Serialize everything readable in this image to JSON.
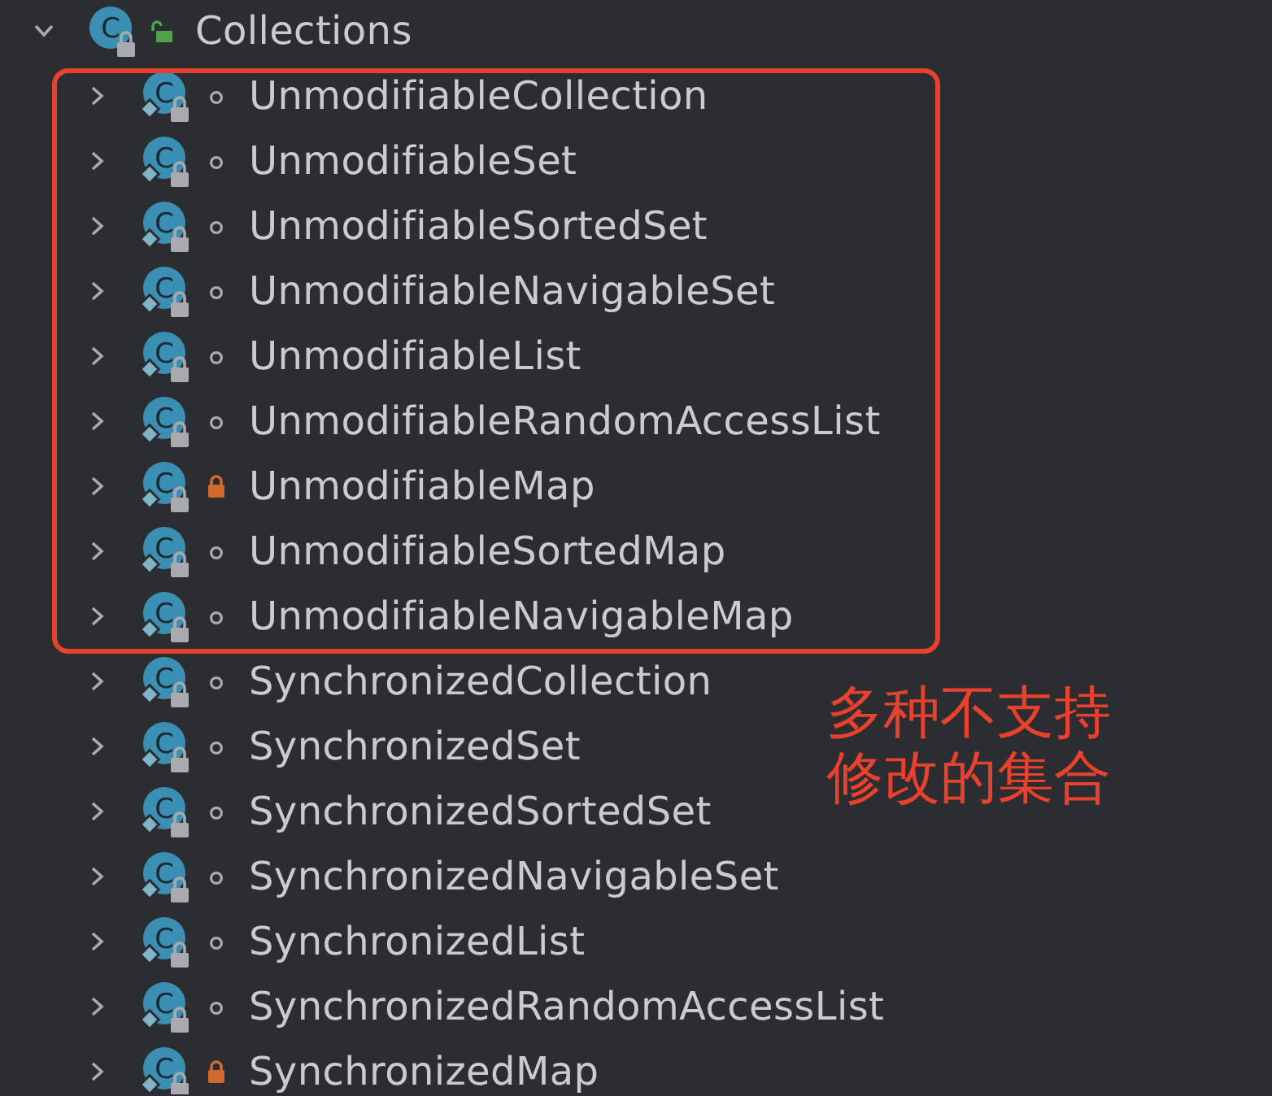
{
  "tree": {
    "label": "Collections",
    "badge": "C",
    "kind": "public",
    "expanded": true,
    "children": [
      {
        "kind": "frame",
        "items": [
          {
            "label": "UnmodifiableCollection",
            "badge": "C",
            "kind": "package",
            "expanded": false
          },
          {
            "label": "UnmodifiableSet",
            "badge": "C",
            "kind": "package",
            "expanded": false
          },
          {
            "label": "UnmodifiableSortedSet",
            "badge": "C",
            "kind": "package",
            "expanded": false
          },
          {
            "label": "UnmodifiableNavigableSet",
            "badge": "C",
            "kind": "package",
            "expanded": false
          },
          {
            "label": "UnmodifiableList",
            "badge": "C",
            "kind": "package",
            "expanded": false
          },
          {
            "label": "UnmodifiableRandomAccessList",
            "badge": "C",
            "kind": "package",
            "expanded": false
          },
          {
            "label": "UnmodifiableMap",
            "badge": "C",
            "kind": "private",
            "expanded": false
          },
          {
            "label": "UnmodifiableSortedMap",
            "badge": "C",
            "kind": "package",
            "expanded": false
          },
          {
            "label": "UnmodifiableNavigableMap",
            "badge": "C",
            "kind": "package",
            "expanded": false
          }
        ]
      },
      {
        "label": "SynchronizedCollection",
        "badge": "C",
        "kind": "package",
        "expanded": false
      },
      {
        "label": "SynchronizedSet",
        "badge": "C",
        "kind": "package",
        "expanded": false
      },
      {
        "label": "SynchronizedSortedSet",
        "badge": "C",
        "kind": "package",
        "expanded": false
      },
      {
        "label": "SynchronizedNavigableSet",
        "badge": "C",
        "kind": "package",
        "expanded": false
      },
      {
        "label": "SynchronizedList",
        "badge": "C",
        "kind": "package",
        "expanded": false
      },
      {
        "label": "SynchronizedRandomAccessList",
        "badge": "C",
        "kind": "package",
        "expanded": false
      },
      {
        "label": "SynchronizedMap",
        "badge": "C",
        "kind": "private",
        "expanded": false
      }
    ]
  },
  "annotation": {
    "lines": [
      "多种不支持",
      "修改的集合"
    ]
  }
}
